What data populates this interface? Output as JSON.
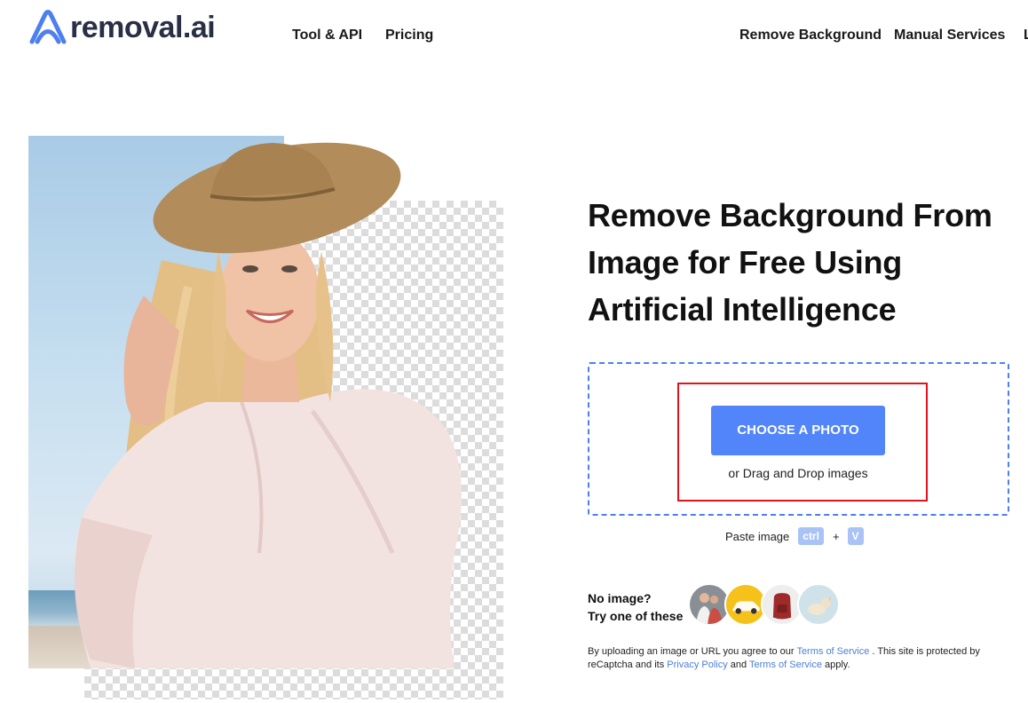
{
  "header": {
    "logo_text": "removal.ai",
    "logo_icon": "removal-logo-icon",
    "nav_left": [
      "Tool & API",
      "Pricing"
    ],
    "nav_right": [
      "Remove Background",
      "Manual Services",
      "L"
    ]
  },
  "hero": {
    "headline": "Remove Background From Image for Free Using Artificial Intelligence"
  },
  "upload": {
    "choose_button": "CHOOSE A PHOTO",
    "drag_text": "or Drag and Drop images",
    "paste_label": "Paste image",
    "key_ctrl": "ctrl",
    "key_plus": "+",
    "key_v": "V"
  },
  "samples": {
    "line1": "No image?",
    "line2": "Try one of these",
    "items": [
      "family-sample",
      "car-sample",
      "backpack-sample",
      "dog-sample"
    ]
  },
  "legal": {
    "part1": "By uploading an image or URL you agree to our ",
    "terms1": "Terms of Service",
    "part2": " . This site is protected by reCaptcha and its ",
    "privacy": "Privacy Policy",
    "part3": " and ",
    "terms2": "Terms of Service",
    "part4": " apply."
  },
  "colors": {
    "accent": "#5185f9",
    "dash_border": "#4c80f1",
    "highlight_red": "#e3121b",
    "link": "#4b7fd6"
  }
}
